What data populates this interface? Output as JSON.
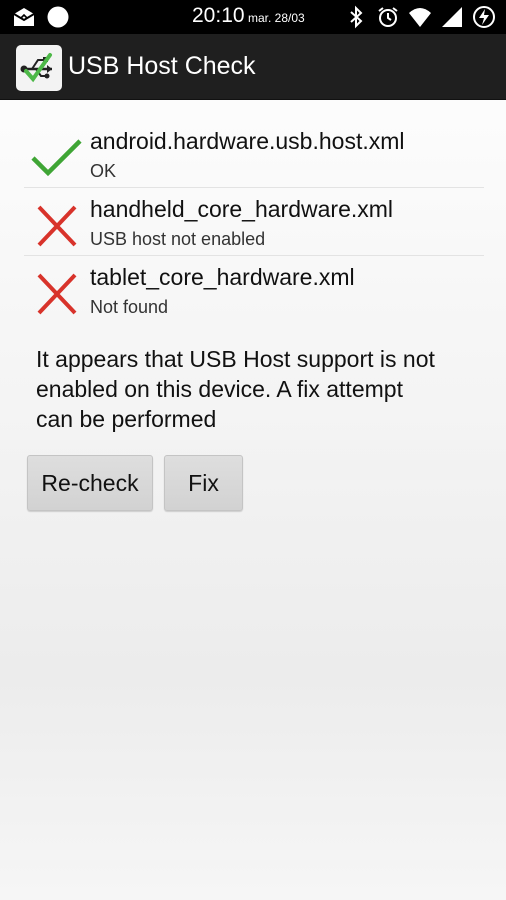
{
  "status_bar": {
    "time": "20:10",
    "date": "mar. 28/03",
    "left_icons": [
      "mail-icon",
      "notification-dot-icon"
    ],
    "right_icons": [
      "bluetooth-icon",
      "alarm-icon",
      "wifi-icon",
      "signal-icon",
      "battery-charging-icon"
    ]
  },
  "app": {
    "title": "USB Host Check",
    "icon": "usb-check-icon"
  },
  "checks": [
    {
      "name": "android.hardware.usb.host.xml",
      "status": "OK",
      "result": "pass",
      "color": "#3fa535"
    },
    {
      "name": "handheld_core_hardware.xml",
      "status": "USB host not enabled",
      "result": "fail",
      "color": "#d8332b"
    },
    {
      "name": "tablet_core_hardware.xml",
      "status": "Not found",
      "result": "fail",
      "color": "#d8332b"
    }
  ],
  "message": "It appears that USB Host support is not enabled on this device. A fix attempt can be performed",
  "buttons": {
    "recheck": "Re-check",
    "fix": "Fix"
  }
}
